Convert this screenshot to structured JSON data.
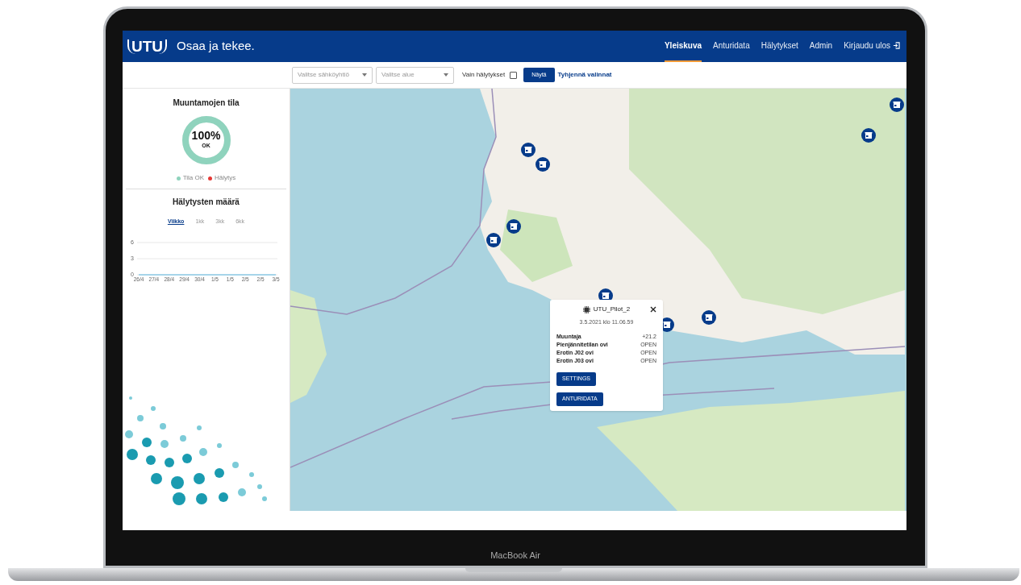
{
  "header": {
    "logo": "UTU",
    "slogan": "Osaa ja tekee.",
    "nav": [
      {
        "label": "Yleiskuva",
        "selected": true
      },
      {
        "label": "Anturidata",
        "selected": false
      },
      {
        "label": "Hälytykset",
        "selected": false
      },
      {
        "label": "Admin",
        "selected": false
      },
      {
        "label": "Kirjaudu ulos",
        "selected": false
      }
    ]
  },
  "filters": {
    "company_select": {
      "placeholder": "Valitse sähköyhtiö"
    },
    "area_select": {
      "placeholder": "Valitse alue"
    },
    "alarms_only": {
      "label": "Vain hälytykset",
      "checked": false
    },
    "show_button": "Näytä",
    "clear_link": "Tyhjennä valinnat"
  },
  "status_panel": {
    "title": "Muuntamojen tila",
    "gauge": {
      "value": "100%",
      "caption": "OK",
      "level": 1
    },
    "legend": [
      {
        "label": "Tila OK",
        "color": "#8fd3bd"
      },
      {
        "label": "Hälytys",
        "color": "#e53935"
      }
    ]
  },
  "alarm_panel": {
    "title": "Hälytysten määrä",
    "periods": [
      {
        "label": "Viikko",
        "selected": true
      },
      {
        "label": "1kk",
        "selected": false
      },
      {
        "label": "3kk",
        "selected": false
      },
      {
        "label": "6kk",
        "selected": false
      }
    ],
    "chart_data": {
      "type": "line",
      "categories": [
        "26/4",
        "27/4",
        "28/4",
        "29/4",
        "30/4",
        "1/5",
        "1/5",
        "2/5",
        "2/5",
        "3/5"
      ],
      "series": [
        {
          "color": "#5bb5e0",
          "values": [
            0,
            0,
            0,
            0,
            0,
            0,
            0,
            0,
            0,
            0
          ]
        }
      ],
      "ylim": [
        0,
        6
      ],
      "yticks": [
        0,
        3,
        6
      ]
    }
  },
  "popup": {
    "title": "UTU_Pilot_2",
    "timestamp": "3.5.2021 klo 11.06.59",
    "rows": [
      {
        "label": "Muuntaja",
        "value": "+21.2"
      },
      {
        "label": "Pienjännitetilan ovi",
        "value": "OPEN"
      },
      {
        "label": "Erotin J02 ovi",
        "value": "OPEN"
      },
      {
        "label": "Erotin J03 ovi",
        "value": "OPEN"
      }
    ],
    "buttons": [
      "SETTINGS",
      "ANTURIDATA"
    ]
  },
  "device": {
    "label": "MacBook Air"
  }
}
